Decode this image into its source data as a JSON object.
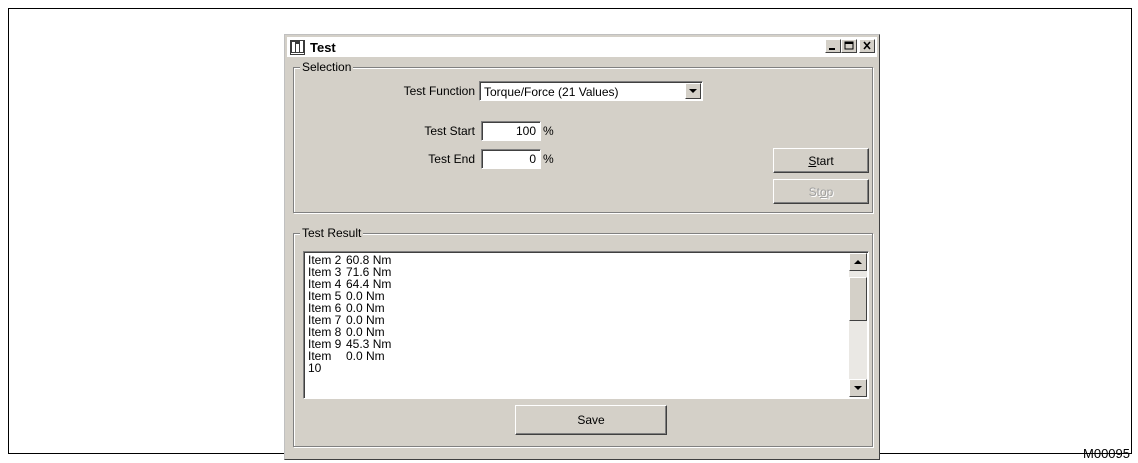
{
  "figure_id": "M00095",
  "window": {
    "title": "Test",
    "controls": [
      "minimize-icon",
      "maximize-icon",
      "close-icon"
    ]
  },
  "selection": {
    "group_label": "Selection",
    "test_function_label": "Test Function",
    "test_function_value": "Torque/Force (21 Values)",
    "test_start_label": "Test Start",
    "test_start_value": "100",
    "test_start_unit": "%",
    "test_end_label": "Test End",
    "test_end_value": "0",
    "test_end_unit": "%",
    "start_button": {
      "mnemonic": "S",
      "rest": "tart"
    },
    "stop_button": {
      "prefix": "St",
      "mnemonic": "o",
      "rest": "p",
      "enabled": false
    }
  },
  "result": {
    "group_label": "Test Result",
    "items": [
      {
        "name": "Item 2",
        "value": "60.8 Nm"
      },
      {
        "name": "Item 3",
        "value": "71.6 Nm"
      },
      {
        "name": "Item 4",
        "value": "64.4 Nm"
      },
      {
        "name": "Item 5",
        "value": "0.0 Nm"
      },
      {
        "name": "Item 6",
        "value": "0.0 Nm"
      },
      {
        "name": "Item 7",
        "value": "0.0 Nm"
      },
      {
        "name": "Item 8",
        "value": "0.0 Nm"
      },
      {
        "name": "Item 9",
        "value": "45.3 Nm"
      },
      {
        "name": "Item 10",
        "value": "0.0 Nm"
      }
    ],
    "save_label": "Save"
  }
}
